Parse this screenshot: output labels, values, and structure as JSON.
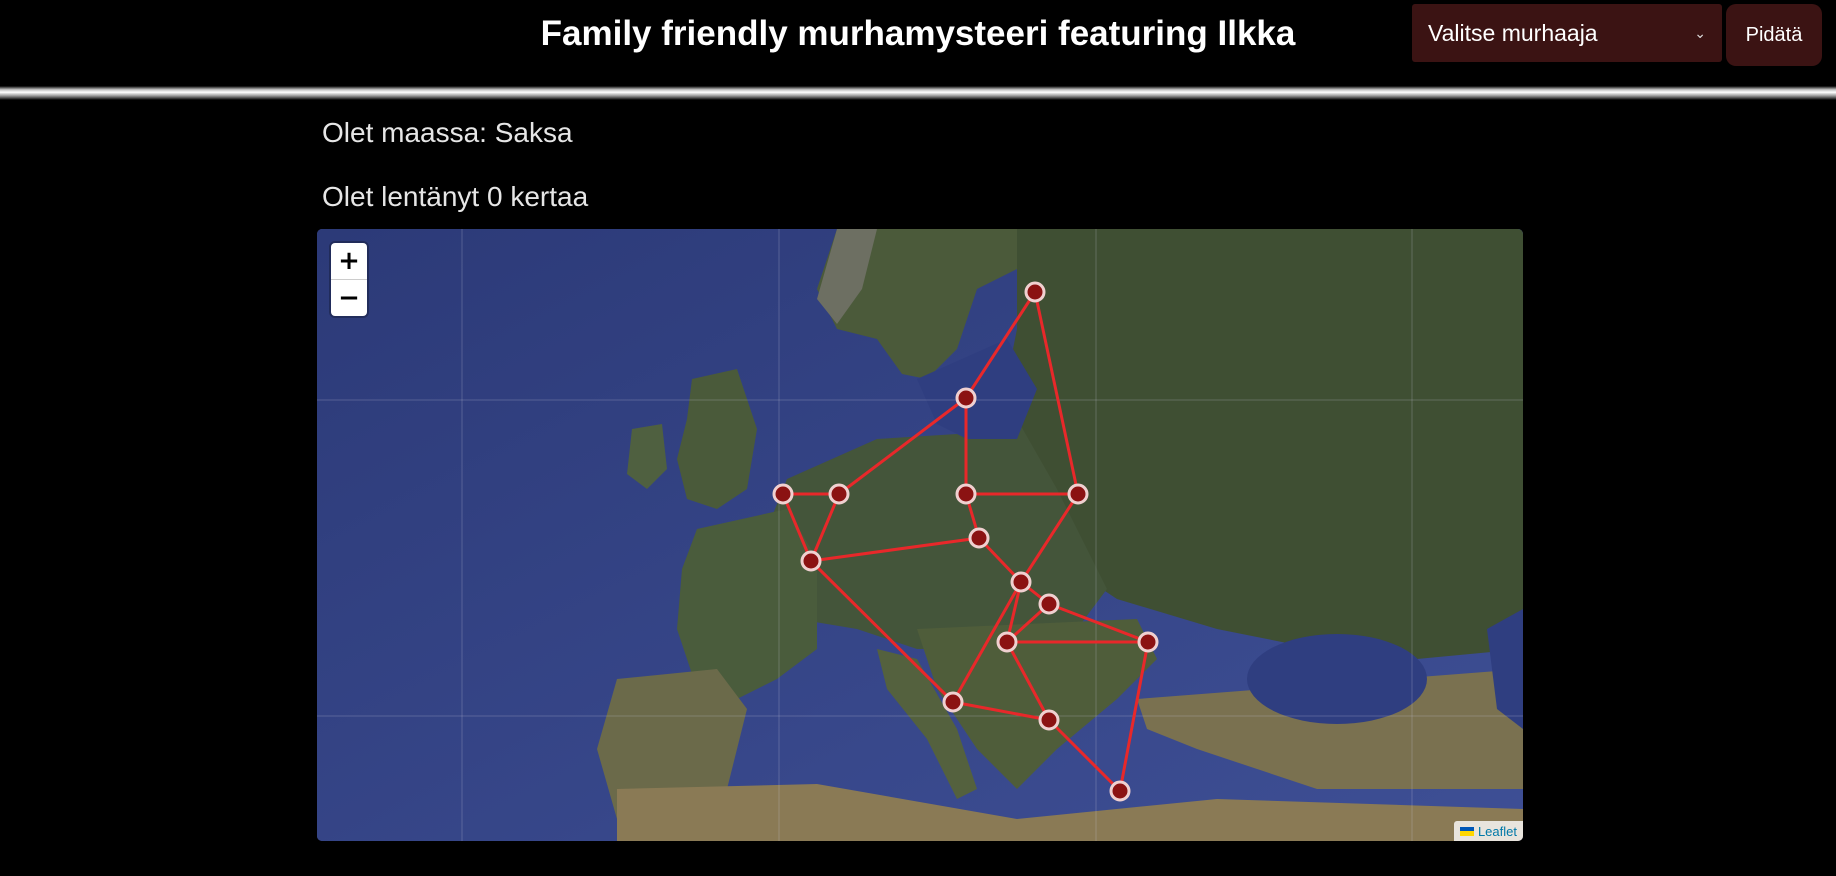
{
  "header": {
    "title": "Family friendly murhamysteeri featuring Ilkka",
    "murderer_select": {
      "value": "Valitse murhaaja"
    },
    "arrest_label": "Pidätä"
  },
  "status": {
    "country_text": "Olet maassa: Saksa",
    "flights_text": "Olet lentänyt 0 kertaa"
  },
  "map": {
    "zoom_in": "+",
    "zoom_out": "−",
    "attribution": "Leaflet",
    "route_color": "#e8282a",
    "marker_fill": "#8b1212",
    "marker_stroke": "#f0d0d0"
  }
}
